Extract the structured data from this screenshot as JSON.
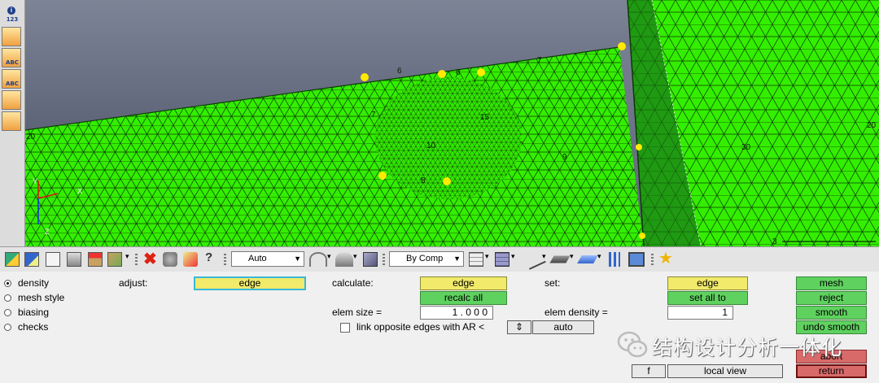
{
  "viewport": {
    "mesh_labels": [
      "6",
      "6",
      "7",
      "7",
      "15",
      "10",
      "9",
      "8",
      "30",
      "20",
      "20",
      "3"
    ],
    "axis_labels": [
      "Y",
      "X",
      "Z"
    ]
  },
  "left_toolbar": {
    "labels": [
      "123",
      "ABC",
      "ABC"
    ]
  },
  "toolbar": {
    "display_mode": "Auto",
    "color_mode": "By Comp"
  },
  "panel": {
    "radios": [
      {
        "label": "density",
        "selected": true
      },
      {
        "label": "mesh style",
        "selected": false
      },
      {
        "label": "biasing",
        "selected": false
      },
      {
        "label": "checks",
        "selected": false
      }
    ],
    "adjust_label": "adjust:",
    "adjust_value": "edge",
    "calculate_label": "calculate:",
    "calculate_value": "edge",
    "recalc_all": "recalc all",
    "elem_size_label": "elem size =",
    "elem_size_value": "1 . 0 0 0",
    "link_label": "link opposite edges with AR <",
    "link_checked": false,
    "auto_label": "auto",
    "set_label": "set:",
    "set_value": "edge",
    "set_all_to": "set all to",
    "elem_density_label": "elem density =",
    "elem_density_value": "1",
    "f_label": "f",
    "local_view": "local view",
    "actions": {
      "mesh": "mesh",
      "reject": "reject",
      "smooth": "smooth",
      "undo_smooth": "undo smooth",
      "abort": "abort",
      "return": "return"
    }
  },
  "watermark": {
    "text": "结构设计分析一体化"
  },
  "colors": {
    "mesh_green": "#33ee00",
    "mesh_dark": "#1f9a12",
    "sky_top": "#7d8496",
    "sky_bottom": "#5e6478",
    "seed_yellow": "#ffea00",
    "button_green": "#5fd15f",
    "button_yellow": "#f1ea6a",
    "button_red": "#d86a6a"
  }
}
